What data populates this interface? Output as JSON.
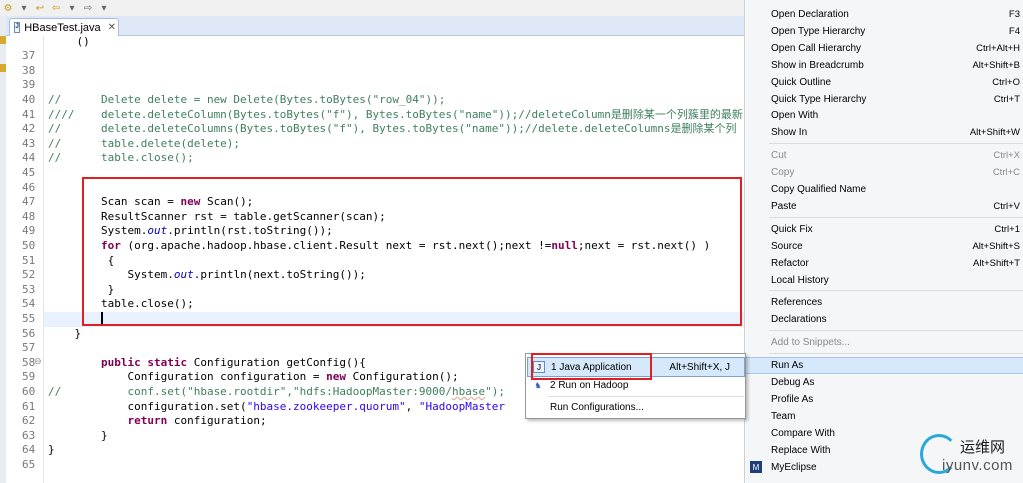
{
  "toolbar": {
    "icons": [
      "build-icon",
      "run-icon",
      "back-icon",
      "forward-icon"
    ],
    "glyphs": [
      "⚙",
      "▾",
      "↩",
      "⇦",
      "▾",
      "⇨",
      "▾"
    ]
  },
  "editor_tab": {
    "label": "HBaseTest.java",
    "close": "✕",
    "file_glyph": "J"
  },
  "code_lines": [
    {
      "num": "37",
      "tokens": []
    },
    {
      "num": "38",
      "tokens": []
    },
    {
      "num": "39",
      "tokens": []
    },
    {
      "num": "40",
      "tokens": [
        {
          "t": "//      Delete delete = new Delete(Bytes.toBytes(\"row_04\"));",
          "c": "cm"
        }
      ]
    },
    {
      "num": "41",
      "tokens": [
        {
          "t": "////    delete.deleteColumn(Bytes.toBytes(\"f\"), Bytes.toBytes(\"name\"));//deleteColumn是删除某一个列簇里的最新",
          "c": "cm"
        }
      ]
    },
    {
      "num": "42",
      "tokens": [
        {
          "t": "//      delete.deleteColumns(Bytes.toBytes(\"f\"), Bytes.toBytes(\"name\"));//delete.deleteColumns是删除某个列",
          "c": "cm"
        }
      ]
    },
    {
      "num": "43",
      "tokens": [
        {
          "t": "//      table.delete(delete);",
          "c": "cm"
        }
      ]
    },
    {
      "num": "44",
      "tokens": [
        {
          "t": "//      table.close();",
          "c": "cm"
        }
      ]
    },
    {
      "num": "45",
      "tokens": []
    },
    {
      "num": "46",
      "tokens": []
    },
    {
      "num": "47",
      "tokens": [
        {
          "t": "        Scan scan = ",
          "c": ""
        },
        {
          "t": "new",
          "c": "kw"
        },
        {
          "t": " Scan();",
          "c": ""
        }
      ]
    },
    {
      "num": "48",
      "tokens": [
        {
          "t": "        ResultScanner rst = table.getScanner(scan);",
          "c": ""
        }
      ]
    },
    {
      "num": "49",
      "tokens": [
        {
          "t": "        System.",
          "c": ""
        },
        {
          "t": "out",
          "c": "fi"
        },
        {
          "t": ".println(rst.toString());",
          "c": ""
        }
      ]
    },
    {
      "num": "50",
      "tokens": [
        {
          "t": "        ",
          "c": ""
        },
        {
          "t": "for",
          "c": "kw"
        },
        {
          "t": " (org.apache.hadoop.hbase.client.Result next = rst.next();next !=",
          "c": ""
        },
        {
          "t": "null",
          "c": "kw"
        },
        {
          "t": ";next = rst.next() )",
          "c": ""
        }
      ]
    },
    {
      "num": "51",
      "tokens": [
        {
          "t": "         {",
          "c": ""
        }
      ]
    },
    {
      "num": "52",
      "tokens": [
        {
          "t": "            System.",
          "c": ""
        },
        {
          "t": "out",
          "c": "fi"
        },
        {
          "t": ".println(next.toString());",
          "c": ""
        }
      ]
    },
    {
      "num": "53",
      "tokens": [
        {
          "t": "         }",
          "c": ""
        }
      ]
    },
    {
      "num": "54",
      "tokens": [
        {
          "t": "        table.close();",
          "c": ""
        }
      ]
    },
    {
      "num": "55",
      "tokens": []
    },
    {
      "num": "56",
      "tokens": [
        {
          "t": "    }",
          "c": ""
        }
      ]
    },
    {
      "num": "57",
      "tokens": []
    },
    {
      "num": "58",
      "tokens": [
        {
          "t": "        ",
          "c": ""
        },
        {
          "t": "public static",
          "c": "kw"
        },
        {
          "t": " Configuration getConfig(){",
          "c": ""
        }
      ]
    },
    {
      "num": "59",
      "tokens": [
        {
          "t": "            Configuration configuration = ",
          "c": ""
        },
        {
          "t": "new",
          "c": "kw"
        },
        {
          "t": " Configuration();",
          "c": ""
        }
      ]
    },
    {
      "num": "60",
      "tokens": [
        {
          "t": "//          conf.set(\"hbase.rootdir\",\"hdfs:",
          "c": "cm"
        },
        {
          "t": "HadoopMaster",
          "c": "cm"
        },
        {
          "t": ":9000/",
          "c": "cm"
        },
        {
          "t": "hbase",
          "c": "cmstr"
        },
        {
          "t": "\");",
          "c": "cm"
        }
      ]
    },
    {
      "num": "61",
      "tokens": [
        {
          "t": "            configuration.set(",
          "c": ""
        },
        {
          "t": "\"hbase.zookeeper.quorum\"",
          "c": "st"
        },
        {
          "t": ", ",
          "c": ""
        },
        {
          "t": "\"HadoopMaster",
          "c": "st"
        }
      ]
    },
    {
      "num": "62",
      "tokens": [
        {
          "t": "            ",
          "c": ""
        },
        {
          "t": "return",
          "c": "kw"
        },
        {
          "t": " configuration;",
          "c": ""
        }
      ]
    },
    {
      "num": "63",
      "tokens": [
        {
          "t": "        }",
          "c": ""
        }
      ]
    },
    {
      "num": "64",
      "tokens": [
        {
          "t": "}",
          "c": ""
        }
      ]
    },
    {
      "num": "65",
      "tokens": []
    }
  ],
  "top_partial": "    ()",
  "context_menu": {
    "items": [
      {
        "label": "Open Declaration",
        "shortcut": "F3",
        "kind": "item"
      },
      {
        "label": "Open Type Hierarchy",
        "shortcut": "F4",
        "kind": "item"
      },
      {
        "label": "Open Call Hierarchy",
        "shortcut": "Ctrl+Alt+H",
        "kind": "item"
      },
      {
        "label": "Show in Breadcrumb",
        "shortcut": "Alt+Shift+B",
        "kind": "item"
      },
      {
        "label": "Quick Outline",
        "shortcut": "Ctrl+O",
        "kind": "item"
      },
      {
        "label": "Quick Type Hierarchy",
        "shortcut": "Ctrl+T",
        "kind": "item"
      },
      {
        "label": "Open With",
        "shortcut": "",
        "kind": "item"
      },
      {
        "label": "Show In",
        "shortcut": "Alt+Shift+W",
        "kind": "item"
      },
      {
        "kind": "sep"
      },
      {
        "label": "Cut",
        "shortcut": "Ctrl+X",
        "kind": "disabled"
      },
      {
        "label": "Copy",
        "shortcut": "Ctrl+C",
        "kind": "disabled"
      },
      {
        "label": "Copy Qualified Name",
        "shortcut": "",
        "kind": "item"
      },
      {
        "label": "Paste",
        "shortcut": "Ctrl+V",
        "kind": "item"
      },
      {
        "kind": "sep"
      },
      {
        "label": "Quick Fix",
        "shortcut": "Ctrl+1",
        "kind": "item"
      },
      {
        "label": "Source",
        "shortcut": "Alt+Shift+S",
        "kind": "item"
      },
      {
        "label": "Refactor",
        "shortcut": "Alt+Shift+T",
        "kind": "item"
      },
      {
        "label": "Local History",
        "shortcut": "",
        "kind": "item"
      },
      {
        "kind": "sep"
      },
      {
        "label": "References",
        "shortcut": "",
        "kind": "item"
      },
      {
        "label": "Declarations",
        "shortcut": "",
        "kind": "item"
      },
      {
        "kind": "sep"
      },
      {
        "label": "Add to Snippets...",
        "shortcut": "",
        "kind": "disabled"
      },
      {
        "kind": "sep"
      },
      {
        "label": "Run As",
        "shortcut": "",
        "kind": "selected"
      },
      {
        "label": "Debug As",
        "shortcut": "",
        "kind": "item"
      },
      {
        "label": "Profile As",
        "shortcut": "",
        "kind": "item"
      },
      {
        "label": "Team",
        "shortcut": "",
        "kind": "item"
      },
      {
        "label": "Compare With",
        "shortcut": "",
        "kind": "item"
      },
      {
        "label": "Replace With",
        "shortcut": "",
        "kind": "item"
      },
      {
        "label": "MyEclipse",
        "shortcut": "",
        "kind": "item"
      }
    ]
  },
  "run_as_submenu": {
    "items": [
      {
        "label": "1 Java Application",
        "shortcut": "Alt+Shift+X, J",
        "icon": "J"
      },
      {
        "label": "2 Run on Hadoop",
        "shortcut": "",
        "icon": "♞"
      },
      {
        "label": "Run Configurations...",
        "shortcut": "",
        "icon": ""
      }
    ]
  },
  "watermark": {
    "cn": "运维网",
    "en": "iyunv.com"
  },
  "colors": {
    "highlight_box": "#e02020",
    "keyword": "#7f0055",
    "comment": "#3f7f5f",
    "string": "#2a00ff"
  }
}
